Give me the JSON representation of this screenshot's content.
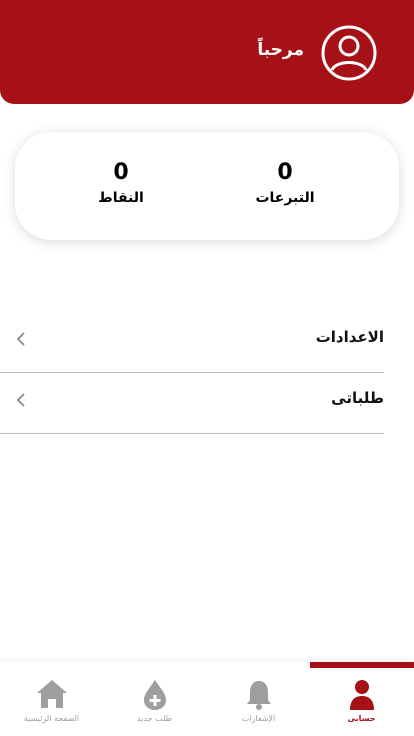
{
  "header": {
    "greeting": "مرحباً",
    "avatar_icon": "user-circle-icon",
    "background": "#a51116"
  },
  "stats": {
    "donations": {
      "value": "0",
      "label": "التبرعات"
    },
    "points": {
      "value": "0",
      "label": "النقاط"
    }
  },
  "menu": {
    "items": [
      {
        "label": "الاعدادات",
        "icon": "chevron-left-icon"
      },
      {
        "label": "طلباتى",
        "icon": "chevron-left-icon"
      }
    ]
  },
  "bottom_nav": {
    "active_color": "#a51116",
    "inactive_color": "#9e9e9e",
    "tabs": [
      {
        "label": "الصفحة الرئيسية",
        "icon": "home-icon",
        "active": false
      },
      {
        "label": "طلب جديد",
        "icon": "blood-drop-plus-icon",
        "active": false
      },
      {
        "label": "الإشعارات",
        "icon": "bell-icon",
        "active": false
      },
      {
        "label": "حسابى",
        "icon": "person-icon",
        "active": true
      }
    ]
  }
}
